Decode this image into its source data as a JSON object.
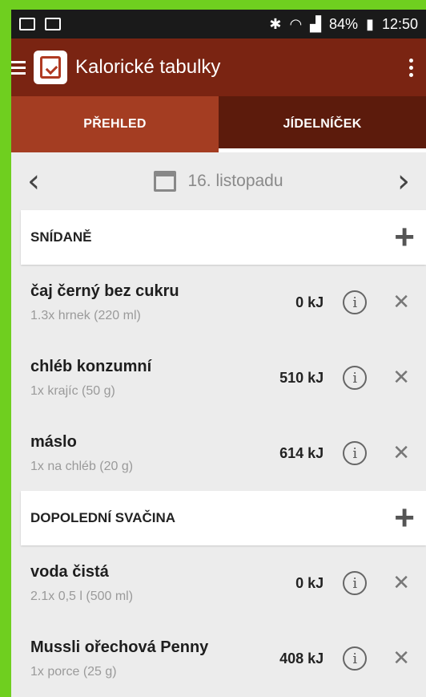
{
  "statusbar": {
    "battery": "84%",
    "time": "12:50"
  },
  "appbar": {
    "title": "Kalorické tabulky",
    "logo_icon": "calorie-tables-logo-icon",
    "menu_icon": "more-vert-icon"
  },
  "tabs": [
    {
      "label": "PŘEHLED"
    },
    {
      "label": "JÍDELNÍČEK",
      "selected": true
    }
  ],
  "datenav": {
    "date": "16. listopadu",
    "prev_icon": "chevron-left-icon",
    "next_icon": "chevron-right-icon"
  },
  "sections": [
    {
      "title": "SNÍDANĚ",
      "items": [
        {
          "name": "čaj černý bez cukru",
          "portion": "1.3x hrnek (220 ml)",
          "energy": "0 kJ"
        },
        {
          "name": "chléb konzumní",
          "portion": "1x krajíc (50 g)",
          "energy": "510 kJ"
        },
        {
          "name": "máslo",
          "portion": "1x na chléb (20 g)",
          "energy": "614 kJ"
        }
      ]
    },
    {
      "title": "DOPOLEDNÍ SVAČINA",
      "items": [
        {
          "name": "voda čistá",
          "portion": "2.1x 0,5 l (500 ml)",
          "energy": "0 kJ"
        },
        {
          "name": "Mussli ořechová Penny",
          "portion": "1x porce (25 g)",
          "energy": "408 kJ"
        }
      ]
    }
  ],
  "colors": {
    "appbar": "#7a2412",
    "tab_inactive": "#a43d22",
    "tab_active": "#5c1b0c",
    "frame": "#6fcf1f"
  }
}
